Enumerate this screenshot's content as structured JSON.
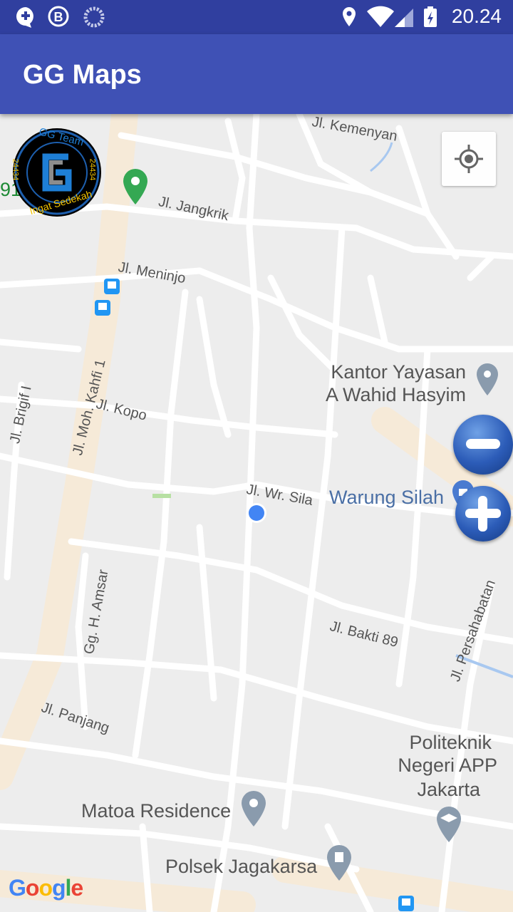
{
  "status_bar": {
    "time": "20.24",
    "left_icons": [
      "chat-plus-icon",
      "bbm-icon",
      "loading-icon"
    ],
    "right_icons": [
      "location-icon",
      "wifi-icon",
      "signal-icon",
      "battery-charging-icon"
    ]
  },
  "app_bar": {
    "title": "GG Maps"
  },
  "map": {
    "streets": [
      "Jl. Kemenyan",
      "Jl. Jangkrik",
      "Jl. Meninjo",
      "Jl. Kopo",
      "Jl. Moh. Kahfi 1",
      "Jl. Brigif I",
      "Jl. Wr. Sila",
      "Gg. H. Amsar",
      "Jl. Bakti 89",
      "Jl. Persahabatan",
      "Jl. Panjang"
    ],
    "pois": {
      "kantor_line1": "Kantor Yayasan",
      "kantor_line2": "A Wahid Hasyim",
      "warung": "Warung Silah",
      "politeknik_line1": "Politeknik",
      "politeknik_line2": "Negeri APP",
      "politeknik_line3": "Jakarta",
      "matoa": "Matoa Residence",
      "polsek": "Polsek Jagakarsa",
      "partial_left": "91",
      "partial_left_end": "ik"
    },
    "google_logo": "Google",
    "logo": {
      "top_text": "GG Team",
      "bottom_text": "Ingat Sedekah",
      "side_left": "24434",
      "side_right": "24434"
    }
  },
  "controls": {
    "my_location": "my-location-icon",
    "zoom_out": "minus-icon",
    "zoom_in": "plus-icon"
  },
  "colors": {
    "status_bar": "#303f9f",
    "app_bar": "#3f51b5",
    "map_bg": "#ededed",
    "road": "#ffffff",
    "main_road": "#f6ead8",
    "poi_text": "#555555",
    "blue_text": "#4a6fa5",
    "green_pin": "#34a853",
    "location_dot": "#4285f4"
  }
}
